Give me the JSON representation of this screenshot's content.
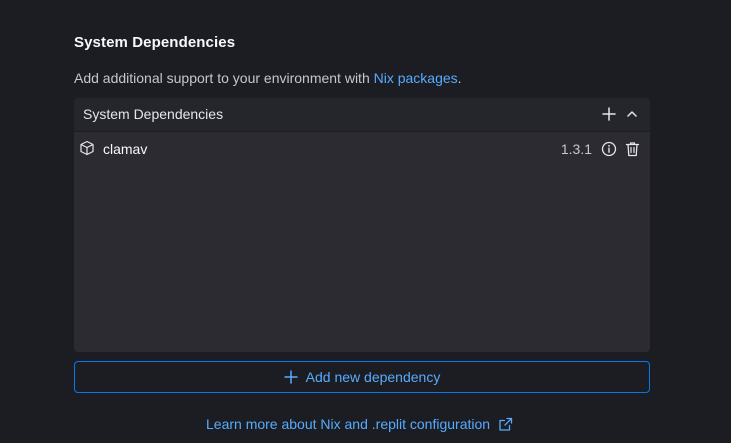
{
  "section": {
    "title": "System Dependencies",
    "description_prefix": "Add additional support to your environment with ",
    "description_link": "Nix packages",
    "description_suffix": "."
  },
  "panel": {
    "title": "System Dependencies",
    "header_icons": [
      "plus-icon",
      "chevron-up-icon"
    ],
    "dependencies": [
      {
        "name": "clamav",
        "version": "1.3.1",
        "icon": "package-icon"
      }
    ]
  },
  "add_button": {
    "label": "Add new dependency",
    "icon": "plus-icon"
  },
  "footer": {
    "link_text": "Learn more about Nix and .replit configuration",
    "icon": "external-link-icon"
  },
  "colors": {
    "background": "#1c1d22",
    "panel": "#2b2b31",
    "panel_header": "#25262b",
    "accent": "#57abff",
    "accent_border": "#0079f2",
    "text": "#f5f9fc",
    "muted": "#c2c8cc"
  }
}
